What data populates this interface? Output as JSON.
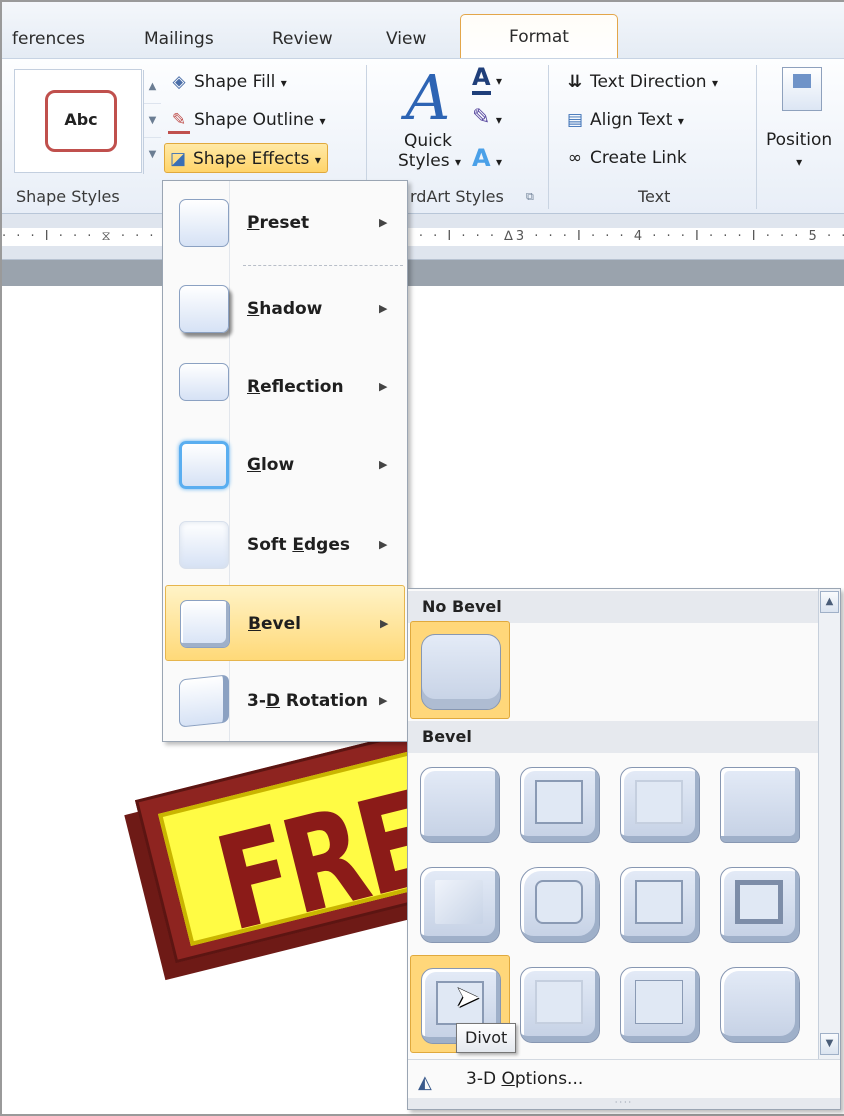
{
  "tabs": {
    "references": "ferences",
    "mailings": "Mailings",
    "review": "Review",
    "view": "View",
    "format": "Format"
  },
  "ribbon": {
    "shape_styles": {
      "thumb_text": "Abc",
      "shape_fill": "Shape Fill",
      "shape_outline": "Shape Outline",
      "shape_effects": "Shape Effects",
      "group_label": "Shape Styles"
    },
    "wordart": {
      "quick_styles_line1": "Quick",
      "quick_styles_line2": "Styles",
      "group_label": "rdArt Styles"
    },
    "text": {
      "text_direction": "Text Direction",
      "align_text": "Align Text",
      "create_link": "Create Link",
      "group_label": "Text"
    },
    "arrange": {
      "position": "Position"
    },
    "dropdown_glyph": "▾"
  },
  "ruler": {
    "marks": "· · · I · · · ⧖ · · · I · · · I · · · I · · · I · · · I · · · I · · · ∆3 · · · I · · · 4 · · · I · · · I · · · 5 · · · I ·"
  },
  "document": {
    "sign_text": "FREE"
  },
  "effects_menu": {
    "items": [
      {
        "prefix": "",
        "mnemonic": "P",
        "rest": "reset"
      },
      {
        "prefix": "",
        "mnemonic": "S",
        "rest": "hadow"
      },
      {
        "prefix": "",
        "mnemonic": "R",
        "rest": "eflection"
      },
      {
        "prefix": "",
        "mnemonic": "G",
        "rest": "low"
      },
      {
        "prefix": "Soft ",
        "mnemonic": "E",
        "rest": "dges"
      },
      {
        "prefix": "",
        "mnemonic": "B",
        "rest": "evel"
      },
      {
        "prefix": "3-",
        "mnemonic": "D",
        "rest": " Rotation"
      }
    ],
    "arrow_glyph": "▶",
    "hovered": "Bevel"
  },
  "bevel_gallery": {
    "no_bevel_header": "No Bevel",
    "bevel_header": "Bevel",
    "tooltip": "Divot",
    "options_prefix": "3-D ",
    "options_mnemonic": "O",
    "options_rest": "ptions...",
    "selected": "Divot",
    "grip": "····"
  },
  "colors": {
    "accent_orange": "#e0a93d",
    "hover_fill": "#ffd77a",
    "sign_red": "#8e2420",
    "sign_yellow": "#fffb44"
  }
}
